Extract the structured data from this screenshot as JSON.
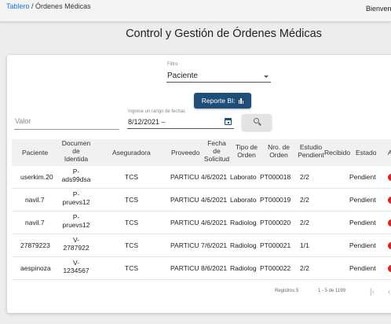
{
  "topbar": {
    "breadcrumb_link": "Tablero",
    "breadcrumb_sep": " / ",
    "breadcrumb_current": "Órdenes Médicas",
    "welcome": "Bienvenid"
  },
  "page": {
    "title": "Control y Gestión de Órdenes Médicas"
  },
  "filters": {
    "filter_label": "Filtro",
    "filter_value": "Paciente",
    "report_button": "Reporte BI:",
    "valor_placeholder": "Valor",
    "date_label": "Ingrese un rango de fechas",
    "date_value": "8/12/2021 –"
  },
  "table": {
    "headers": [
      "Paciente",
      "Documento de Identidad",
      "Aseguradora",
      "Proveedor",
      "Fecha de Solicitud",
      "Tipo de Orden",
      "Nro. de Orden",
      "Estudio Pendiente",
      "Recibido",
      "Estado",
      "A"
    ],
    "header_lines": {
      "paciente": "Paciente",
      "documento": [
        "Documen",
        "de",
        "Identida"
      ],
      "aseguradora": "Aseguradora",
      "proveedor": "Proveedo",
      "fecha": [
        "Fecha",
        "de",
        "Solicitud"
      ],
      "tipo": [
        "Tipo de",
        "Orden"
      ],
      "nro": [
        "Nro. de",
        "Orden"
      ],
      "estudio": [
        "Estudio",
        "Pendient"
      ],
      "recibido": "Recibido",
      "estado": "Estado",
      "accion": "A"
    },
    "rows": [
      {
        "paciente": "userkim.20",
        "doc1": "P-",
        "doc2": "ads99dsa",
        "aseguradora": "TCS",
        "proveedor": "PARTICU",
        "fecha": "4/6/2021",
        "tipo": "Laborato",
        "nro": "PT000018",
        "estudio": "2/2",
        "recibido": "",
        "estado": "Pendient"
      },
      {
        "paciente": "navil.7",
        "doc1": "P-",
        "doc2": "pruevs12",
        "aseguradora": "TCS",
        "proveedor": "PARTICU",
        "fecha": "4/6/2021",
        "tipo": "Laborato",
        "nro": "PT000019",
        "estudio": "2/2",
        "recibido": "",
        "estado": "Pendient"
      },
      {
        "paciente": "navil.7",
        "doc1": "P-",
        "doc2": "pruevs12",
        "aseguradora": "TCS",
        "proveedor": "PARTICU",
        "fecha": "4/6/2021",
        "tipo": "Radiolog",
        "nro": "PT000020",
        "estudio": "2/2",
        "recibido": "",
        "estado": "Pendient"
      },
      {
        "paciente": "27879223",
        "doc1": "V-",
        "doc2": "2787922",
        "aseguradora": "TCS",
        "proveedor": "PARTICU",
        "fecha": "7/6/2021",
        "tipo": "Radiolog",
        "nro": "PT000021",
        "estudio": "1/1",
        "recibido": "",
        "estado": "Pendient"
      },
      {
        "paciente": "aespinoza",
        "doc1": "V-",
        "doc2": "1234567",
        "aseguradora": "TCS",
        "proveedor": "PARTICU",
        "fecha": "8/6/2021",
        "tipo": "Radiolog",
        "nro": "PT000022",
        "estudio": "2/2",
        "recibido": "",
        "estado": "Pendient"
      }
    ]
  },
  "pagination": {
    "label": "Registros 5",
    "range": "1 - 5 de 1199"
  },
  "colors": {
    "primary": "#1f4e79",
    "link": "#1a73e8",
    "status_dot": "#e02020"
  }
}
